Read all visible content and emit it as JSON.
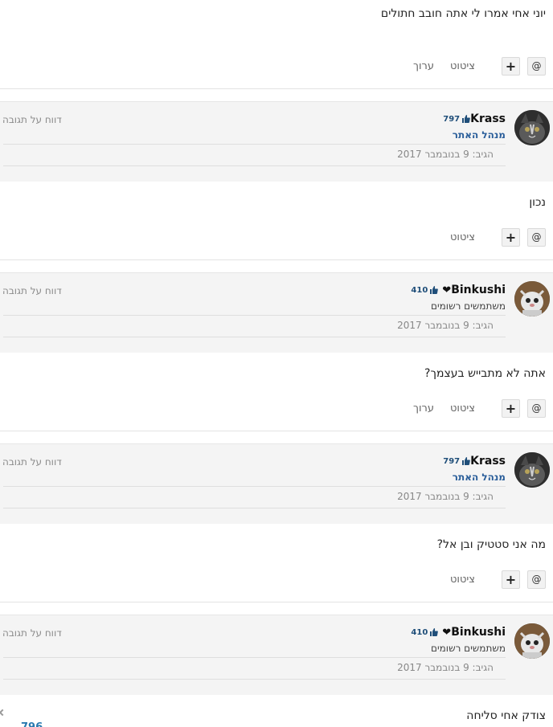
{
  "posts": [
    {
      "text": "יוני אחי אמרו לי אתה חובב חתולים",
      "actions": {
        "at_label": "@",
        "plus_label": "+",
        "quote_label": "ציטוט",
        "edit_label": "ערוך"
      }
    },
    {
      "text": "נכון",
      "actions": {
        "at_label": "@",
        "plus_label": "+",
        "quote_label": "ציטוט"
      }
    },
    {
      "text": "אתה לא מתבייש בעצמך?",
      "actions": {
        "at_label": "@",
        "plus_label": "+",
        "quote_label": "ציטוט",
        "edit_label": "ערוך"
      }
    },
    {
      "text": "מה אני סטטיק ובן אל?",
      "actions": {
        "at_label": "@",
        "plus_label": "+",
        "quote_label": "ציטוט"
      }
    },
    {
      "text": "צודק אחי סליחה"
    }
  ],
  "authors": [
    {
      "name": "Krass",
      "reputation": "797",
      "role": "מנהל האתר",
      "date": "הגיב: 9 בנובמבר 2017",
      "report": "דווח על תגובה"
    },
    {
      "name": "Binkushi",
      "reputation": "410",
      "role": "משתמשים רשומים",
      "date": "הגיב: 9 בנובמבר 2017",
      "report": "דווח על תגובה"
    },
    {
      "name": "Krass",
      "reputation": "797",
      "role": "מנהל האתר",
      "date": "הגיב: 9 בנובמבר 2017",
      "report": "דווח על תגובה"
    },
    {
      "name": "Binkushi",
      "reputation": "410",
      "role": "משתמשים רשומים",
      "date": "הגיב: 9 בנובמבר 2017",
      "report": "דווח על תגובה"
    }
  ],
  "partial": {
    "blue_text": "796"
  },
  "colors": {
    "admin_role": "#2a5e9a",
    "reputation": "#1f4e79",
    "band_bg": "#f4f4f4"
  }
}
